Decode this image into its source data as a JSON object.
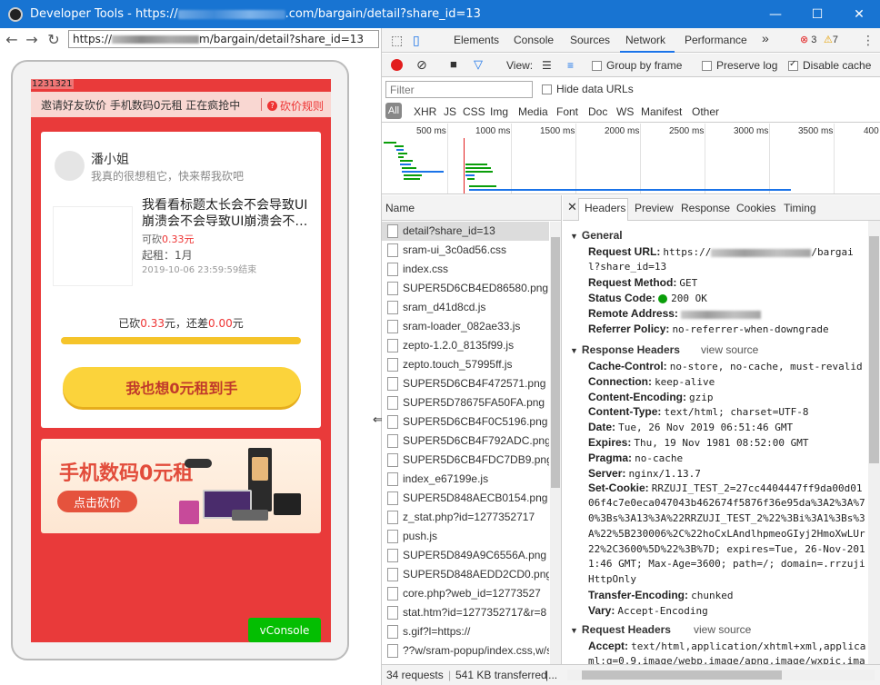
{
  "window": {
    "title_prefix": "Developer Tools - https://",
    "title_suffix": ".com/bargain/detail?share_id=13",
    "minimize": "—",
    "maximize": "☐",
    "close": "✕"
  },
  "browser": {
    "url_prefix": "https://",
    "url_suffix": "m/bargain/detail?share_id=13",
    "back": "←",
    "forward": "→",
    "reload": "↻"
  },
  "page": {
    "id_label": "1231321",
    "notice_text": "邀请好友砍价 手机数码0元租 正在疯抢中",
    "rules_label": "砍价规则",
    "rules_icon": "?",
    "user_name": "潘小姐",
    "user_msg": "我真的很想租它，快来帮我砍吧",
    "goods_title": "我看看标题太长会不会导致UI崩溃会不会导致UI崩溃会不…",
    "cut_label": "可砍",
    "cut_value": "0.33元",
    "rent_label": "起租：1月",
    "end_time": "2019-10-06 23:59:59结束",
    "progress_prefix": "已砍",
    "progress_cut": "0.33",
    "progress_mid": "元，还差",
    "progress_left": "0.00",
    "progress_suffix": "元",
    "progress_fraction": 0.0,
    "cta_label": "我也想0元租到手",
    "banner_title": "手机数码0元租",
    "banner_btn": "点击砍价",
    "vconsole": "vConsole"
  },
  "devtools": {
    "tabs": [
      "Elements",
      "Console",
      "Sources",
      "Network",
      "Performance"
    ],
    "active_tab": "Network",
    "more": "»",
    "errors": "3",
    "warnings": "7",
    "toolbar": {
      "view_label": "View:",
      "group_by_frame": "Group by frame",
      "preserve_log": "Preserve log",
      "disable_cache": "Disable cache"
    },
    "filter_placeholder": "Filter",
    "hide_data_urls": "Hide data URLs",
    "types": [
      "All",
      "XHR",
      "JS",
      "CSS",
      "Img",
      "Media",
      "Font",
      "Doc",
      "WS",
      "Manifest",
      "Other"
    ],
    "timeline_ticks": [
      "500 ms",
      "1000 ms",
      "1500 ms",
      "2000 ms",
      "2500 ms",
      "3000 ms",
      "3500 ms",
      "400"
    ],
    "name_header": "Name",
    "requests": [
      "detail?share_id=13",
      "sram-ui_3c0ad56.css",
      "index.css",
      "SUPER5D6CB4ED86580.png",
      "sram_d41d8cd.js",
      "sram-loader_082ae33.js",
      "zepto-1.2.0_8135f99.js",
      "zepto.touch_57995ff.js",
      "SUPER5D6CB4F472571.png",
      "SUPER5D78675FA50FA.png",
      "SUPER5D6CB4F0C5196.png",
      "SUPER5D6CB4F792ADC.png",
      "SUPER5D6CB4FDC7DB9.png",
      "index_e67199e.js",
      "SUPER5D848AECB0154.png",
      "z_stat.php?id=1277352717",
      "push.js",
      "SUPER5D849A9C6556A.png",
      "SUPER5D848AEDD2CD0.png",
      "core.php?web_id=12773527",
      "stat.htm?id=1277352717&r=8",
      "s.gif?l=https://",
      "??w/sram-popup/index.css,w/s"
    ],
    "detail_tabs": [
      "Headers",
      "Preview",
      "Response",
      "Cookies",
      "Timing"
    ],
    "detail_close": "✕",
    "general_title": "General",
    "general": {
      "request_url_label": "Request URL:",
      "request_url_a": "https://",
      "request_url_b": "/bargai",
      "request_url_c": "l?share_id=13",
      "method_label": "Request Method:",
      "method": "GET",
      "status_label": "Status Code:",
      "status": "200 OK",
      "remote_label": "Remote Address:",
      "referrer_label": "Referrer Policy:",
      "referrer": "no-referrer-when-downgrade"
    },
    "response_title": "Response Headers",
    "view_source": "view source",
    "response": [
      {
        "k": "Cache-Control:",
        "v": "no-store, no-cache, must-revalid"
      },
      {
        "k": "Connection:",
        "v": "keep-alive"
      },
      {
        "k": "Content-Encoding:",
        "v": "gzip"
      },
      {
        "k": "Content-Type:",
        "v": "text/html; charset=UTF-8"
      },
      {
        "k": "Date:",
        "v": "Tue, 26 Nov 2019 06:51:46 GMT"
      },
      {
        "k": "Expires:",
        "v": "Thu, 19 Nov 1981 08:52:00 GMT"
      },
      {
        "k": "Pragma:",
        "v": "no-cache"
      },
      {
        "k": "Server:",
        "v": "nginx/1.13.7"
      },
      {
        "k": "Set-Cookie:",
        "v": "RRZUJI_TEST_2=27cc4404447ff9da00d01"
      }
    ],
    "cookie_cont": [
      "06f4c7e0eca047043b462674f5876f36e95da%3A2%3A%7",
      "0%3Bs%3A13%3A%22RRZUJI_TEST_2%22%3Bi%3A1%3Bs%3",
      "A%22%5B230006%2C%22hoCxLAndlhpmeoGIyj2HmoXwLUr",
      "22%2C3600%5D%22%3B%7D; expires=Tue, 26-Nov-201",
      "1:46 GMT; Max-Age=3600; path=/; domain=.rrzuji",
      " HttpOnly"
    ],
    "response_tail": [
      {
        "k": "Transfer-Encoding:",
        "v": "chunked"
      },
      {
        "k": "Vary:",
        "v": "Accept-Encoding"
      }
    ],
    "request_title": "Request Headers",
    "accept_label": "Accept:",
    "accept_1": "text/html,application/xhtml+xml,applica",
    "accept_2": "ml;q=0.9,image/webp,image/apng,image/wxpic,ima",
    "status_requests": "34 requests",
    "status_transferred": "541 KB transferred",
    "status_more": "|..."
  }
}
